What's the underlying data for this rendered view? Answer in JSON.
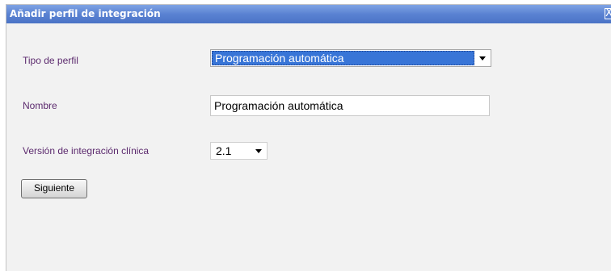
{
  "dialog": {
    "title": "Añadir perfil de integración",
    "close_glyph": "X"
  },
  "form": {
    "profile_type": {
      "label": "Tipo de perfil",
      "selected": "Programación automática"
    },
    "name": {
      "label": "Nombre",
      "value": "Programación automática"
    },
    "version": {
      "label": "Versión de integración clínica",
      "selected": "2.1"
    },
    "next_button_label": "Siguiente"
  },
  "colors": {
    "titlebar": "#5a82d2",
    "label_text": "#5c2a6e",
    "selection_highlight": "#3875d7"
  },
  "icons": {
    "dropdown": "chevron-down-icon",
    "close": "close-icon"
  }
}
